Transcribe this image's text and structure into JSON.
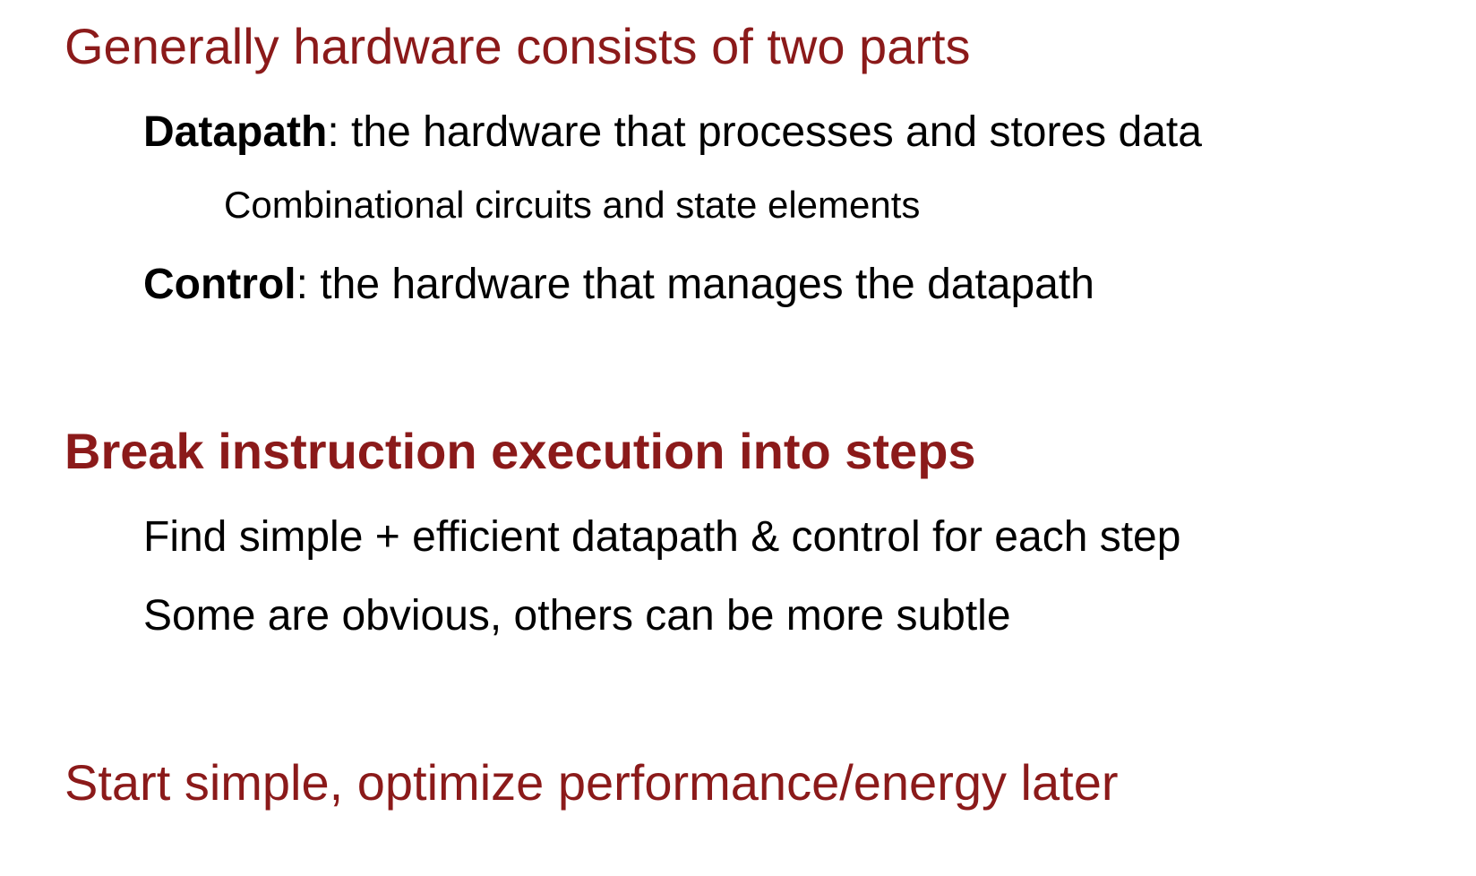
{
  "slide": {
    "heading_1": "Generally hardware consists of two parts",
    "datapath": {
      "term": "Datapath",
      "definition": ": the hardware that processes and stores data"
    },
    "datapath_sub": "Combinational circuits and state elements",
    "control": {
      "term": "Control",
      "definition": ": the hardware that manages the datapath"
    },
    "heading_2": "Break instruction execution into steps",
    "step_bullets": [
      "Find simple + efficient datapath & control for each step",
      "Some are obvious, others can be more subtle"
    ],
    "heading_3": "Start simple, optimize performance/energy later",
    "colors": {
      "heading": "#8b1a1a",
      "body": "#000000"
    }
  }
}
